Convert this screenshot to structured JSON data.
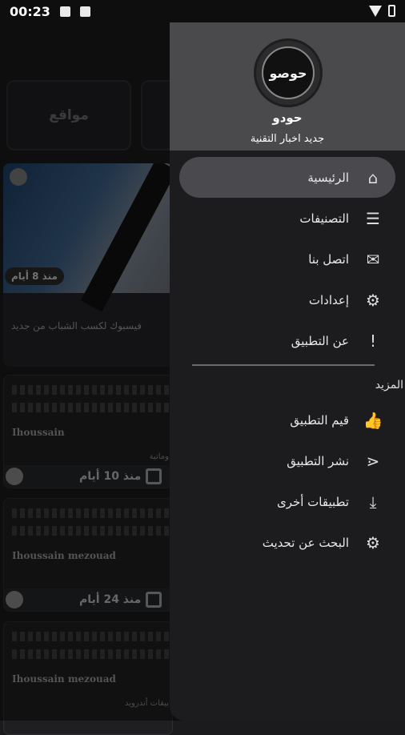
{
  "status_bar": {
    "time": "00:23"
  },
  "background": {
    "category_card": "مواقع",
    "hero": {
      "age": "منذ 8 أيام",
      "snippet": "فيسبوك لكسب الشباب من جديد"
    },
    "posts": [
      {
        "author": "Ihoussain",
        "category": "وماتية",
        "date": "منذ 10 أيام"
      },
      {
        "author": "Ihoussain mezouad",
        "category": "",
        "date": "منذ 24 أيام"
      },
      {
        "author": "Ihoussain mezouad",
        "category": "بيقات أندرويد",
        "date": ""
      }
    ]
  },
  "drawer": {
    "logo_text": "حوصو",
    "app_name": "حودو",
    "app_subtitle": "جديد اخبار التقنية",
    "items": [
      {
        "label": "الرئيسية",
        "icon": "home-icon",
        "glyph": "⌂"
      },
      {
        "label": "التصنيفات",
        "icon": "list-icon",
        "glyph": "☰"
      },
      {
        "label": "اتصل بنا",
        "icon": "mail-icon",
        "glyph": "✉"
      },
      {
        "label": "إعدادات",
        "icon": "gear-icon",
        "glyph": "⚙"
      },
      {
        "label": "عن التطبيق",
        "icon": "feedback-icon",
        "glyph": "!"
      }
    ],
    "section_title": "المزيد",
    "more_items": [
      {
        "label": "قيم التطبيق",
        "icon": "thumbs-up-icon",
        "glyph": "👍"
      },
      {
        "label": "نشر التطبيق",
        "icon": "share-icon",
        "glyph": "⋖"
      },
      {
        "label": "تطبيقات أخرى",
        "icon": "download-icon",
        "glyph": "⤓"
      },
      {
        "label": "البحث عن تحديث",
        "icon": "gear-icon",
        "glyph": "⚙"
      }
    ]
  }
}
